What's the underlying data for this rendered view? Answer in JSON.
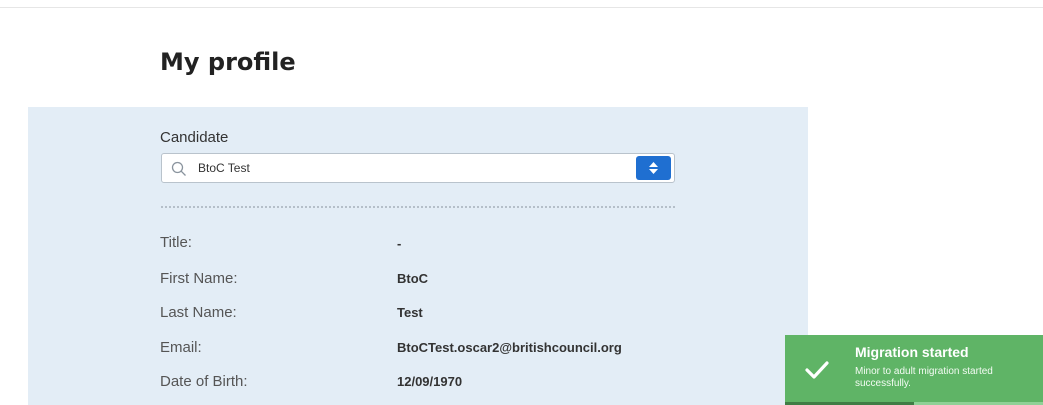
{
  "page": {
    "title": "My profile"
  },
  "candidate": {
    "label": "Candidate",
    "selected": "BtoC Test"
  },
  "profile": {
    "title_label": "Title:",
    "title_value": "-",
    "first_name_label": "First Name:",
    "first_name_value": "BtoC",
    "last_name_label": "Last Name:",
    "last_name_value": "Test",
    "email_label": "Email:",
    "email_value": "BtoCTest.oscar2@britishcouncil.org",
    "dob_label": "Date of Birth:",
    "dob_value": "12/09/1970"
  },
  "toast": {
    "title": "Migration started",
    "message": "Minor to adult migration started successfully.",
    "progress_fraction": 0.5
  },
  "icons": {
    "search": "search-icon",
    "select_toggle": "sort-arrows-icon",
    "toast": "check-icon"
  },
  "colors": {
    "panel_bg": "#e3edf6",
    "accent": "#1f6fd1",
    "toast_bg": "#5fb466"
  }
}
